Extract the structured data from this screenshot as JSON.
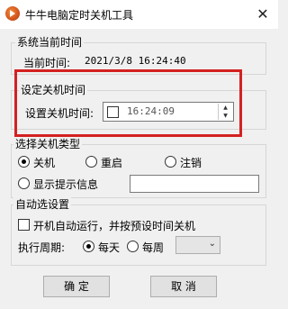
{
  "window": {
    "title": "牛牛电脑定时关机工具",
    "close_glyph": "✕"
  },
  "system_time": {
    "group_label": "系统当前时间",
    "label": "当前时间:",
    "value": "2021/3/8 16:24:40"
  },
  "shutdown_time": {
    "group_label": "设定关机时间",
    "label": "设置关机时间:",
    "value": "16:24:09"
  },
  "shutdown_type": {
    "group_label": "选择关机类型",
    "options": [
      "关机",
      "重启",
      "注销",
      "显示提示信息"
    ],
    "selected": "关机",
    "message_value": ""
  },
  "auto_options": {
    "group_label": "自动选设置",
    "autostart_label": "开机自动运行，并按预设时间关机",
    "period_label": "执行周期:",
    "period_options": [
      "每天",
      "每周"
    ],
    "period_selected": "每天",
    "weekday_value": ""
  },
  "buttons": {
    "ok": "确  定",
    "cancel": "取  消"
  },
  "colors": {
    "highlight": "#d42020"
  }
}
